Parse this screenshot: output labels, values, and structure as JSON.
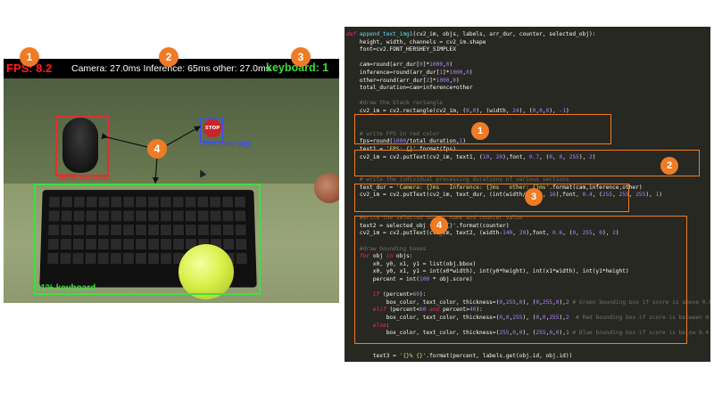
{
  "camera_view": {
    "fps": "FPS: 8.2",
    "timings": "Camera: 27.0ms  Inference: 65ms  other: 27.0ms",
    "keyboard_count": "keyboard: 1",
    "detections": [
      {
        "label": "98% mouse",
        "color": "#e03030"
      },
      {
        "label": "91% keyboard",
        "color": "#3ee03e"
      },
      {
        "label": "26% stop sign",
        "color": "#3a4aff"
      }
    ],
    "stop_sign_text": "STOP"
  },
  "callouts": [
    "1",
    "2",
    "3",
    "4"
  ],
  "code_lines": [
    [
      [
        "kw",
        "def "
      ],
      [
        "fn",
        "append_text_img1"
      ],
      [
        "",
        "(cv2_im, objs, labels, arr_dur, counter, selected_obj):"
      ]
    ],
    [
      [
        "",
        "    height, width, channels = cv2_im.shape"
      ]
    ],
    [
      [
        "",
        "    font=cv2.FONT_HERSHEY_SIMPLEX"
      ]
    ],
    [
      [
        "",
        ""
      ]
    ],
    [
      [
        "",
        "    cam=round(arr_dur["
      ],
      [
        "num",
        "0"
      ],
      [
        "",
        "]*"
      ],
      [
        "num",
        "1000"
      ],
      [
        "",
        ","
      ],
      [
        "num",
        "0"
      ],
      [
        "",
        ")"
      ]
    ],
    [
      [
        "",
        "    inference=round(arr_dur["
      ],
      [
        "num",
        "1"
      ],
      [
        "",
        "]*"
      ],
      [
        "num",
        "1000"
      ],
      [
        "",
        ","
      ],
      [
        "num",
        "0"
      ],
      [
        "",
        ")"
      ]
    ],
    [
      [
        "",
        "    other=round(arr_dur["
      ],
      [
        "num",
        "2"
      ],
      [
        "",
        "]*"
      ],
      [
        "num",
        "1000"
      ],
      [
        "",
        ","
      ],
      [
        "num",
        "0"
      ],
      [
        "",
        ")"
      ]
    ],
    [
      [
        "",
        "    total_duration=cam+inference+other"
      ]
    ],
    [
      [
        "",
        ""
      ]
    ],
    [
      [
        "cm",
        "    #draw the black rectangle"
      ]
    ],
    [
      [
        "",
        "    cv2_im = cv2.rectangle(cv2_im, ("
      ],
      [
        "num",
        "0"
      ],
      [
        "",
        ","
      ],
      [
        "num",
        "0"
      ],
      [
        "",
        "), (width, "
      ],
      [
        "num",
        "24"
      ],
      [
        "",
        "), ("
      ],
      [
        "num",
        "0"
      ],
      [
        "",
        ","
      ],
      [
        "num",
        "0"
      ],
      [
        "",
        ","
      ],
      [
        "num",
        "0"
      ],
      [
        "",
        "), "
      ],
      [
        "num",
        "-1"
      ],
      [
        "",
        ")"
      ]
    ],
    [
      [
        "",
        ""
      ]
    ],
    [
      [
        "",
        ""
      ]
    ],
    [
      [
        "cm",
        "    # write FPS in red color"
      ]
    ],
    [
      [
        "",
        "    fps=round("
      ],
      [
        "num",
        "1000"
      ],
      [
        "",
        "/total_duration,"
      ],
      [
        "num",
        "1"
      ],
      [
        "",
        ")"
      ]
    ],
    [
      [
        "",
        "    text1 = "
      ],
      [
        "str",
        "'FPS: {}'"
      ],
      [
        "",
        ".format(fps)"
      ]
    ],
    [
      [
        "",
        "    cv2_im = cv2.putText(cv2_im, text1, ("
      ],
      [
        "num",
        "10"
      ],
      [
        "",
        ", "
      ],
      [
        "num",
        "20"
      ],
      [
        "",
        "),font, "
      ],
      [
        "num",
        "0.7"
      ],
      [
        "",
        ", ("
      ],
      [
        "num",
        "0"
      ],
      [
        "",
        ", "
      ],
      [
        "num",
        "0"
      ],
      [
        "",
        ", "
      ],
      [
        "num",
        "255"
      ],
      [
        "",
        "), "
      ],
      [
        "num",
        "2"
      ],
      [
        "",
        ")"
      ]
    ],
    [
      [
        "",
        ""
      ]
    ],
    [
      [
        "",
        ""
      ]
    ],
    [
      [
        "cm",
        "    # write the individual processing durations of various sections"
      ]
    ],
    [
      [
        "",
        "    text_dur = "
      ],
      [
        "str",
        "'Camera: {}ms   Inference: {}ms   other: {}ms'"
      ],
      [
        "",
        ".format(cam,inference,other)"
      ]
    ],
    [
      [
        "",
        "    cv2_im = cv2.putText(cv2_im, text_dur, (int(width/"
      ],
      [
        "num",
        "4"
      ],
      [
        "",
        ")-"
      ],
      [
        "num",
        "30"
      ],
      [
        "",
        ", "
      ],
      [
        "num",
        "16"
      ],
      [
        "",
        "),font, "
      ],
      [
        "num",
        "0.4"
      ],
      [
        "",
        ", ("
      ],
      [
        "num",
        "255"
      ],
      [
        "",
        ", "
      ],
      [
        "num",
        "255"
      ],
      [
        "",
        ", "
      ],
      [
        "num",
        "255"
      ],
      [
        "",
        "), "
      ],
      [
        "num",
        "1"
      ],
      [
        "",
        ")"
      ]
    ],
    [
      [
        "",
        ""
      ]
    ],
    [
      [
        "",
        ""
      ]
    ],
    [
      [
        "cm",
        "    #write the selected object name and counter value"
      ]
    ],
    [
      [
        "",
        "    text2 = selected_obj + "
      ],
      [
        "str",
        "': {}'"
      ],
      [
        "",
        ".format(counter)"
      ]
    ],
    [
      [
        "",
        "    cv2_im = cv2.putText(cv2_im, text2, (width-"
      ],
      [
        "num",
        "140"
      ],
      [
        "",
        ", "
      ],
      [
        "num",
        "20"
      ],
      [
        "",
        "),font, "
      ],
      [
        "num",
        "0.6"
      ],
      [
        "",
        ", ("
      ],
      [
        "num",
        "0"
      ],
      [
        "",
        ", "
      ],
      [
        "num",
        "255"
      ],
      [
        "",
        ", "
      ],
      [
        "num",
        "0"
      ],
      [
        "",
        "), "
      ],
      [
        "num",
        "2"
      ],
      [
        "",
        ")"
      ]
    ],
    [
      [
        "",
        ""
      ]
    ],
    [
      [
        "cm",
        "    #draw bounding boxes"
      ]
    ],
    [
      [
        "kw",
        "    for "
      ],
      [
        "",
        "obj "
      ],
      [
        "kw",
        "in "
      ],
      [
        "",
        "objs:"
      ]
    ],
    [
      [
        "",
        "        x0, y0, x1, y1 = list(obj.bbox)"
      ]
    ],
    [
      [
        "",
        "        x0, y0, x1, y1 = int(x0*width), int(y0*height), int(x1*width), int(y1*height)"
      ]
    ],
    [
      [
        "",
        "        percent = int("
      ],
      [
        "num",
        "100"
      ],
      [
        "",
        " * obj.score)"
      ]
    ],
    [
      [
        "",
        ""
      ]
    ],
    [
      [
        "kw",
        "        if "
      ],
      [
        "",
        "(percent>"
      ],
      [
        "num",
        "60"
      ],
      [
        "",
        "):"
      ]
    ],
    [
      [
        "",
        "            box_color, text_color, thickness=("
      ],
      [
        "num",
        "0"
      ],
      [
        "",
        ","
      ],
      [
        "num",
        "255"
      ],
      [
        "",
        ","
      ],
      [
        "num",
        "0"
      ],
      [
        "",
        "), ("
      ],
      [
        "num",
        "0"
      ],
      [
        "",
        ","
      ],
      [
        "num",
        "255"
      ],
      [
        "",
        ","
      ],
      [
        "num",
        "0"
      ],
      [
        "",
        "),"
      ],
      [
        "num",
        "2"
      ],
      [
        "cm",
        " # Green bounding box if score is above 0.6"
      ]
    ],
    [
      [
        "kw",
        "        elif "
      ],
      [
        "",
        "(percent<"
      ],
      [
        "num",
        "60"
      ],
      [
        "",
        ""
      ],
      [
        "kw",
        " and "
      ],
      [
        "",
        "percent>"
      ],
      [
        "num",
        "40"
      ],
      [
        "",
        "):"
      ]
    ],
    [
      [
        "",
        "            box_color, text_color, thickness=("
      ],
      [
        "num",
        "0"
      ],
      [
        "",
        ","
      ],
      [
        "num",
        "0"
      ],
      [
        "",
        ","
      ],
      [
        "num",
        "255"
      ],
      [
        "",
        "), ("
      ],
      [
        "num",
        "0"
      ],
      [
        "",
        ","
      ],
      [
        "num",
        "0"
      ],
      [
        "",
        ","
      ],
      [
        "num",
        "255"
      ],
      [
        "",
        "),"
      ],
      [
        "num",
        "2"
      ],
      [
        "cm",
        "  # Red bounding box if score is between 0.4"
      ]
    ],
    [
      [
        "kw",
        "        else"
      ],
      [
        "",
        ":"
      ]
    ],
    [
      [
        "",
        "            box_color, text_color, thickness=("
      ],
      [
        "num",
        "255"
      ],
      [
        "",
        ","
      ],
      [
        "num",
        "0"
      ],
      [
        "",
        ","
      ],
      [
        "num",
        "0"
      ],
      [
        "",
        "), ("
      ],
      [
        "num",
        "255"
      ],
      [
        "",
        ","
      ],
      [
        "num",
        "0"
      ],
      [
        "",
        ","
      ],
      [
        "num",
        "0"
      ],
      [
        "",
        "),"
      ],
      [
        "num",
        "1"
      ],
      [
        "cm",
        " # Blue bounding box if score is below 0.4"
      ]
    ],
    [
      [
        "",
        ""
      ]
    ],
    [
      [
        "",
        ""
      ]
    ],
    [
      [
        "",
        "        text3 = "
      ],
      [
        "str",
        "'{}% {}'"
      ],
      [
        "",
        ".format(percent, labels.get(obj.id, obj.id))"
      ]
    ],
    [
      [
        "",
        ""
      ]
    ],
    [
      [
        "",
        "        cv2_im = cv2.rectangle(cv2_im, (x0, y0), (x1, y1), box_color, thickness)"
      ]
    ],
    [
      [
        "",
        "        cv2_im = cv2.putText(cv2_im, text3, (x0, y1-"
      ],
      [
        "num",
        "5"
      ],
      [
        "",
        "),font, "
      ],
      [
        "num",
        "0.5"
      ],
      [
        "",
        ", text_color, thickness)"
      ]
    ],
    [
      [
        "",
        ""
      ]
    ],
    [
      [
        "kw",
        "    return "
      ],
      [
        "",
        "cv2_im"
      ]
    ]
  ]
}
